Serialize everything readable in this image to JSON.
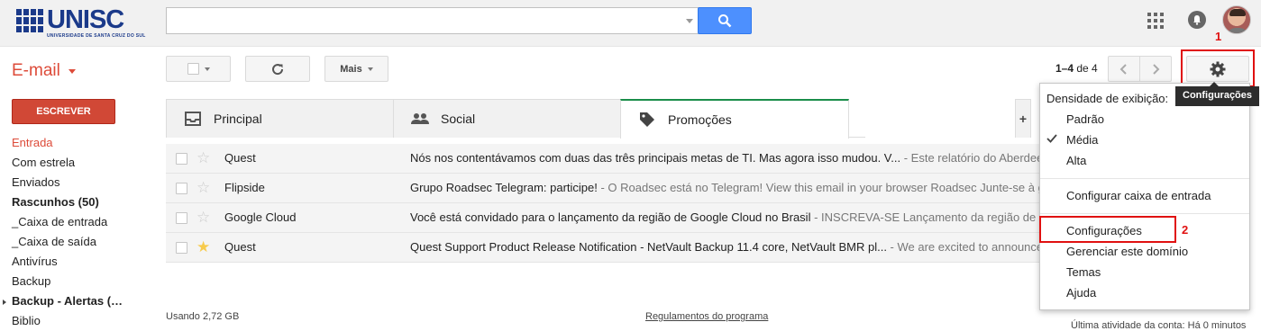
{
  "brand": {
    "name": "UNISC",
    "subtitle": "UNIVERSIDADE DE SANTA CRUZ DO SUL"
  },
  "search": {
    "placeholder": "",
    "value": ""
  },
  "header_icons": [
    "apps-grid-icon",
    "notifications-bell-icon",
    "account-avatar"
  ],
  "app_switcher": {
    "label": "E-mail"
  },
  "toolbar": {
    "more_label": "Mais",
    "count_range": "1–4",
    "count_of": "de 4",
    "gear_tooltip": "Configurações"
  },
  "compose_label": "ESCREVER",
  "nav": [
    {
      "label": "Entrada",
      "active": true,
      "bold": false
    },
    {
      "label": "Com estrela",
      "active": false,
      "bold": false
    },
    {
      "label": "Enviados",
      "active": false,
      "bold": false
    },
    {
      "label": "Rascunhos (50)",
      "active": false,
      "bold": true
    },
    {
      "label": "_Caixa de entrada",
      "active": false,
      "bold": false
    },
    {
      "label": "_Caixa de saída",
      "active": false,
      "bold": false
    },
    {
      "label": "Antivírus",
      "active": false,
      "bold": false
    },
    {
      "label": "Backup",
      "active": false,
      "bold": false
    },
    {
      "label": "Backup - Alertas (…",
      "active": false,
      "bold": true
    },
    {
      "label": "Biblio",
      "active": false,
      "bold": false
    }
  ],
  "tabs": [
    {
      "label": "Principal",
      "icon": "inbox-tray-icon",
      "selected": false
    },
    {
      "label": "Social",
      "icon": "people-icon",
      "selected": false
    },
    {
      "label": "Promoções",
      "icon": "tag-icon",
      "selected": true
    }
  ],
  "tab_add_label": "+",
  "emails": [
    {
      "sender": "Quest",
      "starred": false,
      "subject": "Nós nos contentávamos com duas das três principais metas de TI. Mas agora isso mudou. V...",
      "snippet": " - Este relatório do Aberdeen"
    },
    {
      "sender": "Flipside",
      "starred": false,
      "subject": "Grupo Roadsec Telegram: participe!",
      "snippet": " - O Roadsec está no Telegram! View this email in your browser Roadsec Junte-se à ga"
    },
    {
      "sender": "Google Cloud",
      "starred": false,
      "subject": "Você está convidado para o lançamento da região de Google Cloud no Brasil",
      "snippet": " - INSCREVA-SE Lançamento da região de C"
    },
    {
      "sender": "Quest",
      "starred": true,
      "subject": "Quest Support Product Release Notification - NetVault Backup 11.4 core, NetVault BMR pl...",
      "snippet": " - We are excited to announce a"
    }
  ],
  "footer": {
    "usage": "Usando 2,72 GB",
    "rules": "Regulamentos do programa",
    "activity": "Última atividade da conta: Há 0 minutos"
  },
  "settings_menu": {
    "density_heading": "Densidade de exibição:",
    "density_options": [
      "Padrão",
      "Média",
      "Alta"
    ],
    "density_selected": "Média",
    "configure_inbox": "Configurar caixa de entrada",
    "settings": "Configurações",
    "manage_domain": "Gerenciar este domínio",
    "themes": "Temas",
    "help": "Ajuda"
  },
  "annotations": {
    "step1": "1",
    "step2": "2"
  },
  "colors": {
    "accent_red": "#dd4b39",
    "compose_red": "#d14836",
    "search_blue": "#4d90fe",
    "promo_green": "#1a8d4a",
    "annotation_red": "#e01010"
  }
}
